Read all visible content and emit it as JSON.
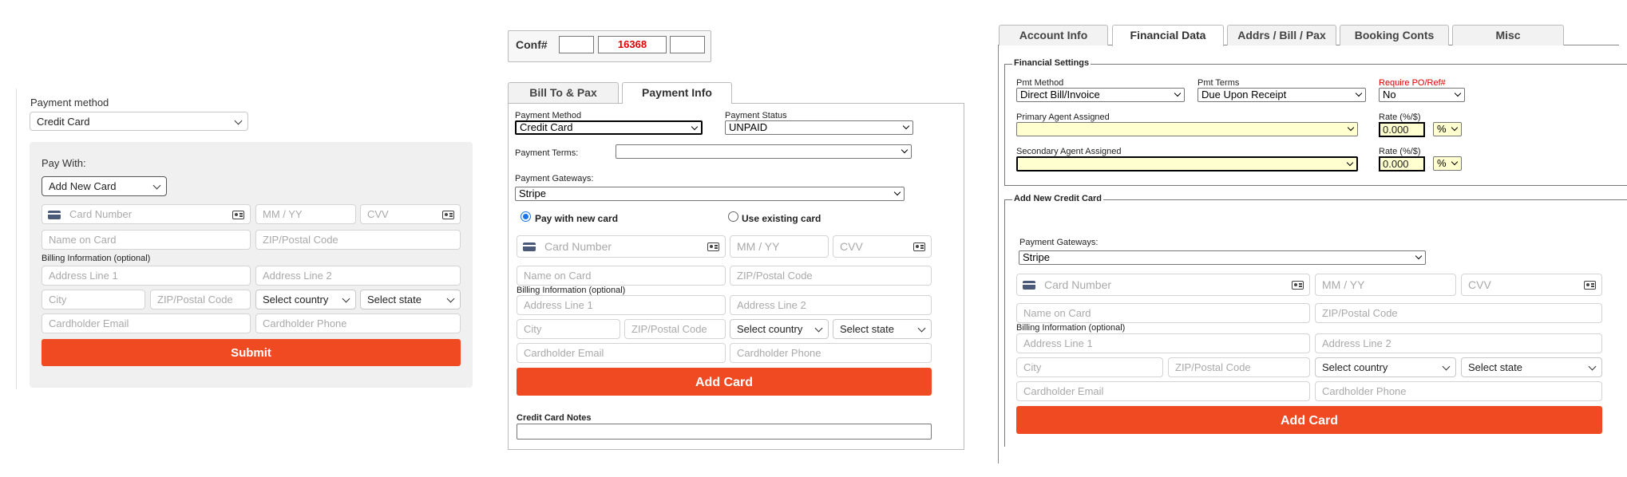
{
  "common": {
    "card_number": "Card Number",
    "mm_yy": "MM / YY",
    "cvv": "CVV",
    "name_on_card": "Name on Card",
    "zip": "ZIP/Postal Code",
    "billing_info": "Billing Information (optional)",
    "address1": "Address Line 1",
    "address2": "Address Line 2",
    "city": "City",
    "country": "Select country",
    "state": "Select state",
    "email": "Cardholder Email",
    "phone": "Cardholder Phone"
  },
  "panel1": {
    "payment_method_label": "Payment method",
    "payment_method_value": "Credit Card",
    "pay_with_label": "Pay With:",
    "pay_with_value": "Add New Card",
    "submit_label": "Submit"
  },
  "panel2": {
    "conf_label": "Conf#",
    "conf_values": [
      "",
      "16368",
      ""
    ],
    "tabs": [
      "Bill To & Pax",
      "Payment Info"
    ],
    "payment_method_label": "Payment Method",
    "payment_method_value": "Credit Card",
    "payment_status_label": "Payment Status",
    "payment_status_value": "UNPAID",
    "payment_terms_label": "Payment Terms:",
    "payment_terms_value": "",
    "gateways_label": "Payment Gateways:",
    "gateway_value": "Stripe",
    "radio_new": "Pay with new card",
    "radio_existing": "Use existing card",
    "add_card_label": "Add Card",
    "notes_label": "Credit Card Notes"
  },
  "panel3": {
    "tabs": [
      "Account Info",
      "Financial Data",
      "Addrs / Bill / Pax",
      "Booking Conts",
      "Misc"
    ],
    "financial_settings": "Financial Settings",
    "pmt_method_label": "Pmt Method",
    "pmt_method_value": "Direct Bill/Invoice",
    "pmt_terms_label": "Pmt Terms",
    "pmt_terms_value": "Due Upon Receipt",
    "require_po_label": "Require PO/Ref#",
    "require_po_value": "No",
    "primary_agent_label": "Primary Agent Assigned",
    "rate_label": "Rate (%/$)",
    "rate_value": "0.000",
    "rate_unit": "%",
    "secondary_agent_label": "Secondary Agent Assigned",
    "add_new_cc": "Add New Credit Card",
    "gateways_label": "Payment Gateways:",
    "gateway_value": "Stripe",
    "add_card_label": "Add Card"
  }
}
